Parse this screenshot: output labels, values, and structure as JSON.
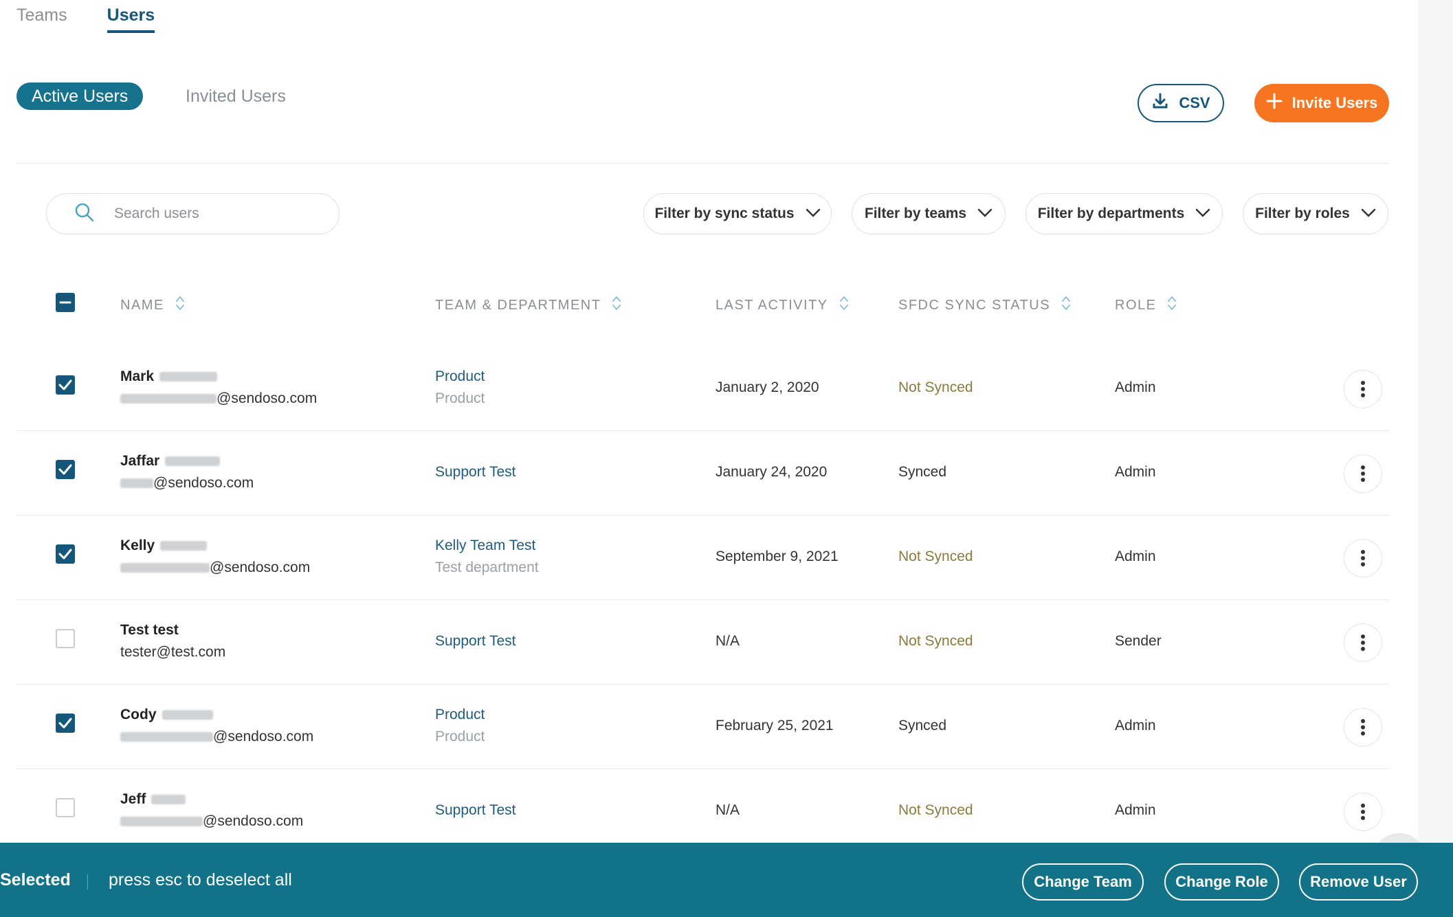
{
  "top_tabs": [
    {
      "label": "Teams",
      "active": false
    },
    {
      "label": "Users",
      "active": true
    }
  ],
  "sub_tabs": {
    "active": "Active Users",
    "inactive": "Invited Users"
  },
  "actions": {
    "csv_label": "CSV",
    "invite_label": "Invite Users"
  },
  "search": {
    "placeholder": "Search users",
    "value": ""
  },
  "filters": {
    "sync": "Filter by sync status",
    "teams": "Filter by teams",
    "departments": "Filter by departments",
    "roles": "Filter by roles"
  },
  "columns": {
    "name": "NAME",
    "team": "TEAM & DEPARTMENT",
    "activity": "LAST ACTIVITY",
    "sync": "SFDC SYNC STATUS",
    "role": "ROLE"
  },
  "rows": [
    {
      "checked": true,
      "first": "Mark",
      "email_domain": "@sendoso.com",
      "team": "Product",
      "dept": "Product",
      "activity": "January 2, 2020",
      "sync": "Not Synced",
      "synced": false,
      "role": "Admin"
    },
    {
      "checked": true,
      "first": "Jaffar",
      "email_domain": "@sendoso.com",
      "team": "Support Test",
      "dept": "",
      "activity": "January 24, 2020",
      "sync": "Synced",
      "synced": true,
      "role": "Admin"
    },
    {
      "checked": true,
      "first": "Kelly",
      "email_domain": "@sendoso.com",
      "team": "Kelly Team Test",
      "dept": "Test department",
      "activity": "September 9, 2021",
      "sync": "Not Synced",
      "synced": false,
      "role": "Admin"
    },
    {
      "checked": false,
      "first": "Test test",
      "email_domain": "tester@test.com",
      "team": "Support Test",
      "dept": "",
      "activity": "N/A",
      "sync": "Not Synced",
      "synced": false,
      "role": "Sender"
    },
    {
      "checked": true,
      "first": "Cody",
      "email_domain": "@sendoso.com",
      "team": "Product",
      "dept": "Product",
      "activity": "February 25, 2021",
      "sync": "Synced",
      "synced": true,
      "role": "Admin"
    },
    {
      "checked": false,
      "first": "Jeff",
      "email_domain": "@sendoso.com",
      "team": "Support Test",
      "dept": "",
      "activity": "N/A",
      "sync": "Not Synced",
      "synced": false,
      "role": "Admin"
    }
  ],
  "bottom_bar": {
    "selected_label": "Selected",
    "hint": "press esc to deselect all",
    "change_team": "Change Team",
    "change_role": "Change Role",
    "remove_user": "Remove User"
  },
  "colors": {
    "accent": "#14577a",
    "bar": "#117288",
    "invite": "#f77520",
    "not_synced": "#8a7a3b"
  }
}
